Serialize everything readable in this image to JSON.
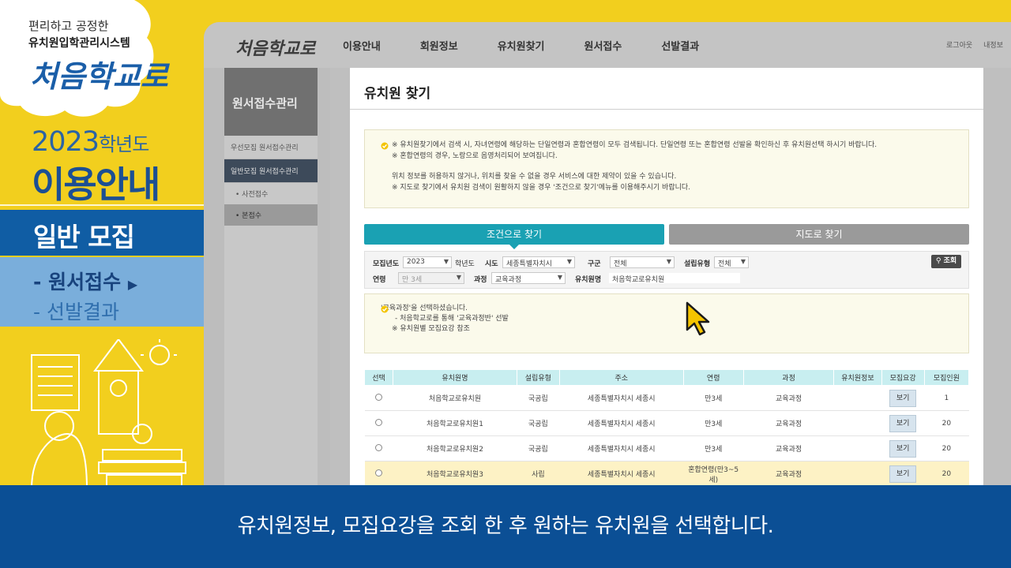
{
  "left_panel": {
    "cloud_line1": "편리하고 공정한",
    "cloud_line2": "유치원입학관리시스템",
    "logo_text": "처음학교로",
    "year": "2023",
    "year_suffix": "학년도",
    "guide_title": "이용안내",
    "banner": "일반 모집",
    "sub_item_1": "- 원서접수",
    "sub_item_2": "- 선발결과",
    "colors": {
      "yellow": "#f2cf1e",
      "blue": "#105da4",
      "light_blue": "#7aaedb",
      "orange": "#f08a24"
    }
  },
  "site": {
    "logo": "처음학교로",
    "nav": [
      "이용안내",
      "회원정보",
      "유치원찾기",
      "원서접수",
      "선발결과"
    ],
    "right_links": [
      "로그아웃",
      "내정보"
    ],
    "sidebar": {
      "heading": "원서접수관리",
      "items": [
        "우선모집 원서접수관리",
        "일반모집 원서접수관리"
      ],
      "subs": [
        "• 사전접수",
        "• 본접수"
      ]
    }
  },
  "modal": {
    "title": "유치원 찾기",
    "notice_lines": [
      "※ 유치원찾기에서 검색 시, 자녀연령에 해당하는 단일연령과 혼합연령이 모두 검색됩니다. 단일연령 또는 혼합연령 선발을 확인하신 후 유치원선택 하시기 바랍니다.",
      "※ 혼합연령의 경우, 노랑으로 음영처리되어 보여집니다.",
      "",
      "위치 정보를 허용하지 않거나, 위치를 찾을 수 없을 경우 서비스에 대한 제약이 있을 수 있습니다.",
      "※ 지도로 찾기에서 유치원 검색이 원활하지 않을 경우 '조건으로 찾기'메뉴를 이용해주시기 바랍니다."
    ],
    "tab_condition": "조건으로 찾기",
    "tab_map": "지도로 찾기",
    "filters": {
      "year_label": "모집년도",
      "year_value": "2023",
      "year_suffix": "학년도",
      "sido_label": "시도",
      "sido_value": "세종특별자치시",
      "gugun_label": "구군",
      "gugun_value": "전체",
      "type_label": "설립유형",
      "type_value": "전체",
      "age_label": "연령",
      "age_value": "만 3세",
      "course_label": "과정",
      "course_value": "교육과정",
      "name_label": "유치원명",
      "name_value": "처음학교로유치원",
      "search_button": "조회"
    },
    "info_lines": [
      "'교육과정'을 선택하셨습니다.",
      "- 처음학교로를 통해 '교육과정반' 선발",
      "※ 유치원별 모집요강 참조"
    ],
    "table": {
      "headers": [
        "선택",
        "유치원명",
        "설립유형",
        "주소",
        "연령",
        "과정",
        "유치원정보",
        "모집요강",
        "모집인원"
      ],
      "rows": [
        {
          "name": "처음학교로유치원",
          "type": "국공립",
          "address": "세종특별자치시 세종시",
          "age": "만3세",
          "course": "교육과정",
          "info": "",
          "guide": "보기",
          "count": "1"
        },
        {
          "name": "처음학교로유치원1",
          "type": "국공립",
          "address": "세종특별자치시 세종시",
          "age": "만3세",
          "course": "교육과정",
          "info": "",
          "guide": "보기",
          "count": "20"
        },
        {
          "name": "처음학교로유치원2",
          "type": "국공립",
          "address": "세종특별자치시 세종시",
          "age": "만3세",
          "course": "교육과정",
          "info": "",
          "guide": "보기",
          "count": "20"
        },
        {
          "name": "처음학교로유치원3",
          "type": "사립",
          "address": "세종특별자치시 세종시",
          "age": "혼합연령(만3~5세)",
          "course": "교육과정",
          "info": "",
          "guide": "보기",
          "count": "20"
        }
      ]
    }
  },
  "subtitle": "유치원정보, 모집요강을 조회 한 후 원하는 유치원을 선택합니다."
}
